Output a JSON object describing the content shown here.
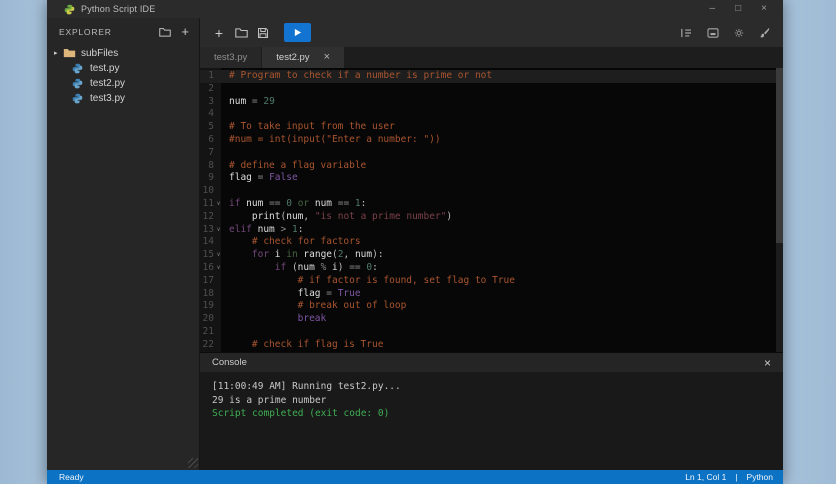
{
  "window": {
    "title": "Python Script IDE",
    "controls": [
      {
        "name": "minimize",
        "glyph": "–"
      },
      {
        "name": "maximize",
        "glyph": "□"
      },
      {
        "name": "close",
        "glyph": "×"
      }
    ]
  },
  "explorer": {
    "header": "EXPLORER",
    "new_file_glyph": "+",
    "files": [
      {
        "name": "subFiles",
        "icon": "folder",
        "arrow": "▸"
      },
      {
        "name": "test.py",
        "icon": "python"
      },
      {
        "name": "test2.py",
        "icon": "python"
      },
      {
        "name": "test3.py",
        "icon": "python"
      }
    ]
  },
  "toolbar": {
    "plus_glyph": "+",
    "icons": [
      "plus-icon",
      "folder-icon",
      "floppy-save-icon",
      "play-icon",
      "format-list-icon",
      "panel-icon",
      "gear-icon",
      "brush-icon"
    ]
  },
  "tabs": [
    {
      "label": "test3.py",
      "active": false,
      "close_glyph": ""
    },
    {
      "label": "test2.py",
      "active": true,
      "close_glyph": "×"
    }
  ],
  "editor": {
    "lines": [
      {
        "n": 1,
        "hl": true,
        "fold": false,
        "tk": [
          [
            "cm",
            "# Program to check if a number is prime or not"
          ]
        ]
      },
      {
        "n": 2,
        "hl": false,
        "fold": false,
        "tk": []
      },
      {
        "n": 3,
        "hl": false,
        "fold": false,
        "tk": [
          [
            "v",
            "num "
          ],
          [
            "o",
            "= "
          ],
          [
            "num",
            "29"
          ]
        ]
      },
      {
        "n": 4,
        "hl": false,
        "fold": false,
        "tk": []
      },
      {
        "n": 5,
        "hl": false,
        "fold": false,
        "tk": [
          [
            "cm",
            "# To take input from the user"
          ]
        ]
      },
      {
        "n": 6,
        "hl": false,
        "fold": false,
        "tk": [
          [
            "cm",
            "#num = int(input(\"Enter a number: \"))"
          ]
        ]
      },
      {
        "n": 7,
        "hl": false,
        "fold": false,
        "tk": []
      },
      {
        "n": 8,
        "hl": false,
        "fold": false,
        "tk": [
          [
            "cm",
            "# define a flag variable"
          ]
        ]
      },
      {
        "n": 9,
        "hl": false,
        "fold": false,
        "tk": [
          [
            "v",
            "flag "
          ],
          [
            "o",
            "= "
          ],
          [
            "kw2",
            "False"
          ]
        ]
      },
      {
        "n": 10,
        "hl": false,
        "fold": false,
        "tk": []
      },
      {
        "n": 11,
        "hl": false,
        "fold": true,
        "tk": [
          [
            "kw",
            "if "
          ],
          [
            "v",
            "num "
          ],
          [
            "o",
            "== "
          ],
          [
            "num",
            "0 "
          ],
          [
            "opw",
            "or "
          ],
          [
            "v",
            "num "
          ],
          [
            "o",
            "== "
          ],
          [
            "num",
            "1"
          ],
          [
            "t",
            ":"
          ]
        ]
      },
      {
        "n": 12,
        "hl": false,
        "fold": false,
        "tk": [
          [
            "t",
            "    "
          ],
          [
            "v",
            "print"
          ],
          [
            "t",
            "("
          ],
          [
            "v",
            "num"
          ],
          [
            "t",
            ", "
          ],
          [
            "str",
            "\"is not a prime number\""
          ],
          [
            "t",
            ")"
          ]
        ]
      },
      {
        "n": 13,
        "hl": false,
        "fold": true,
        "tk": [
          [
            "kw",
            "elif "
          ],
          [
            "v",
            "num "
          ],
          [
            "o",
            "> "
          ],
          [
            "num",
            "1"
          ],
          [
            "t",
            ":"
          ]
        ]
      },
      {
        "n": 14,
        "hl": false,
        "fold": false,
        "tk": [
          [
            "t",
            "    "
          ],
          [
            "cm",
            "# check for factors"
          ]
        ]
      },
      {
        "n": 15,
        "hl": false,
        "fold": true,
        "tk": [
          [
            "t",
            "    "
          ],
          [
            "kw",
            "for "
          ],
          [
            "v",
            "i "
          ],
          [
            "opw",
            "in "
          ],
          [
            "v",
            "range"
          ],
          [
            "t",
            "("
          ],
          [
            "num",
            "2"
          ],
          [
            "t",
            ", "
          ],
          [
            "v",
            "num"
          ],
          [
            "t",
            "):"
          ]
        ]
      },
      {
        "n": 16,
        "hl": false,
        "fold": true,
        "tk": [
          [
            "t",
            "        "
          ],
          [
            "kw",
            "if "
          ],
          [
            "t",
            "("
          ],
          [
            "v",
            "num "
          ],
          [
            "o",
            "% "
          ],
          [
            "v",
            "i"
          ],
          [
            "t",
            ") "
          ],
          [
            "o",
            "== "
          ],
          [
            "num",
            "0"
          ],
          [
            "t",
            ":"
          ]
        ]
      },
      {
        "n": 17,
        "hl": false,
        "fold": false,
        "tk": [
          [
            "t",
            "            "
          ],
          [
            "cm",
            "# if factor is found, set flag to True"
          ]
        ]
      },
      {
        "n": 18,
        "hl": false,
        "fold": false,
        "tk": [
          [
            "t",
            "            "
          ],
          [
            "v",
            "flag "
          ],
          [
            "o",
            "= "
          ],
          [
            "kw2",
            "True"
          ]
        ]
      },
      {
        "n": 19,
        "hl": false,
        "fold": false,
        "tk": [
          [
            "t",
            "            "
          ],
          [
            "cm",
            "# break out of loop"
          ]
        ]
      },
      {
        "n": 20,
        "hl": false,
        "fold": false,
        "tk": [
          [
            "t",
            "            "
          ],
          [
            "kw2",
            "break"
          ]
        ]
      },
      {
        "n": 21,
        "hl": false,
        "fold": false,
        "tk": []
      },
      {
        "n": 22,
        "hl": false,
        "fold": false,
        "tk": [
          [
            "t",
            "    "
          ],
          [
            "cm",
            "# check if flag is True"
          ]
        ]
      }
    ]
  },
  "console": {
    "title": "Console",
    "close_glyph": "×",
    "lines": [
      {
        "kind": "log",
        "text": "[11:00:49 AM] Running test2.py..."
      },
      {
        "kind": "log",
        "text": "29 is a prime number"
      },
      {
        "kind": "success",
        "text": "Script completed (exit code: 0)"
      }
    ]
  },
  "statusbar": {
    "ready": "Ready",
    "position": "Ln 1, Col 1",
    "separator": "|",
    "language": "Python"
  },
  "colors": {
    "accent_run_button": "#1273d0",
    "statusbar": "#0c72c4",
    "console_success": "#3fae54",
    "comment": "#a9552f",
    "keyword": "#74477c",
    "keyword_bright": "#7e57a3",
    "word_operator": "#47653f",
    "number": "#4f7a6a",
    "string": "#79404a",
    "folder_icon": "#dcb67a",
    "python_icon": "#3e7fb2"
  }
}
